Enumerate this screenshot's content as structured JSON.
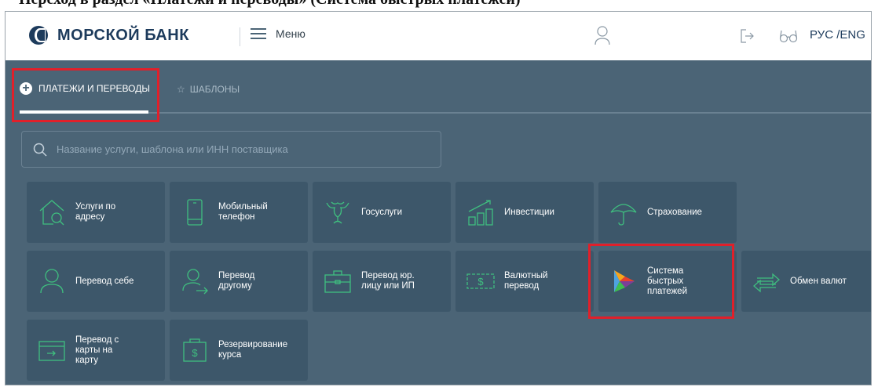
{
  "caption": {
    "text": "Переход в раздел «Платежи и переводы» (Система быстрых платежей)"
  },
  "header": {
    "logo_text": "МОРСКОЙ БАНК",
    "menu_label": "Меню",
    "language": "РУС /ENG"
  },
  "tabs": [
    {
      "label": "ПЛАТЕЖИ И ПЕРЕВОДЫ",
      "active": true,
      "icon": "plus-circle-icon"
    },
    {
      "label": "ШАБЛОНЫ",
      "active": false,
      "icon": "star-icon"
    }
  ],
  "search": {
    "placeholder": "Название услуги, шаблона или ИНН поставщика",
    "value": ""
  },
  "services": [
    {
      "label": "Услуги по\nадресу",
      "icon": "house-search-icon"
    },
    {
      "label": "Мобильный\nтелефон",
      "icon": "smartphone-icon"
    },
    {
      "label": "Госуслуги",
      "icon": "emblem-icon"
    },
    {
      "label": "Инвестиции",
      "icon": "growth-chart-icon"
    },
    {
      "label": "Страхование",
      "icon": "umbrella-icon"
    },
    {
      "label": "Перевод себе",
      "icon": "user-icon"
    },
    {
      "label": "Перевод\nдругому",
      "icon": "user-transfer-icon"
    },
    {
      "label": "Перевод юр.\nлицу или ИП",
      "icon": "briefcase-icon"
    },
    {
      "label": "Валютный\nперевод",
      "icon": "banknote-icon"
    },
    {
      "label": "Система\nбыстрых\nплатежей",
      "icon": "sbp-logo-icon"
    },
    {
      "label": "Обмен валют",
      "icon": "exchange-arrows-icon"
    },
    {
      "label": "Перевод с\nкарты на\nкарту",
      "icon": "card-transfer-icon"
    },
    {
      "label": "Резервирование\nкурса",
      "icon": "dollar-wallet-icon"
    }
  ],
  "colors": {
    "brand": "#1d3b5c",
    "background": "#4b6476",
    "tile": "#3d576a",
    "icon_accent": "#3fbf7f",
    "highlight": "#e0202a"
  }
}
